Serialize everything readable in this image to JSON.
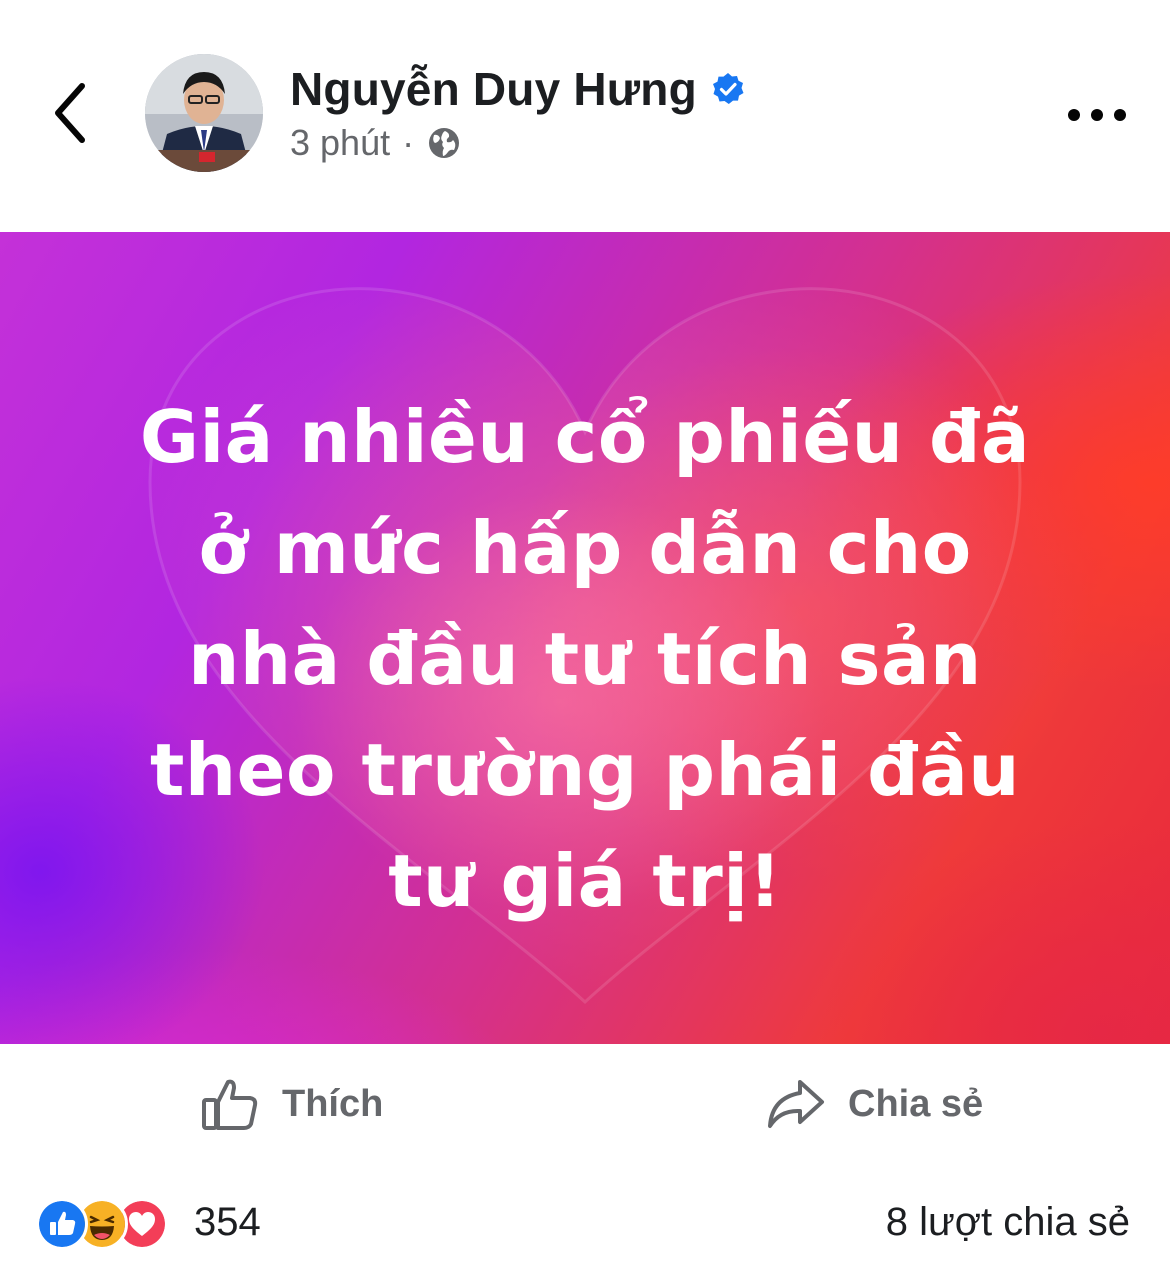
{
  "post": {
    "author": {
      "name": "Nguyễn Duy Hưng",
      "verified": true
    },
    "time": "3 phút",
    "separator": "·",
    "privacy_icon": "globe-icon",
    "text_lines": [
      "Giá nhiều cổ phiếu đã",
      "ở mức hấp dẫn cho",
      "nhà đầu tư tích sản",
      "theo trường phái đầu",
      "tư giá trị!"
    ],
    "background_colors": [
      "#c431d8",
      "#d4308e",
      "#ef3a3a"
    ]
  },
  "actions": {
    "like_label": "Thích",
    "share_label": "Chia sẻ"
  },
  "stats": {
    "reaction_icons": [
      "like-reaction-icon",
      "haha-reaction-icon",
      "love-reaction-icon"
    ],
    "reaction_count": "354",
    "shares": "8 lượt chia sẻ"
  },
  "colors": {
    "accent": "#1877f2",
    "muted": "#65676b",
    "love": "#f33e58",
    "haha": "#f7b125"
  }
}
